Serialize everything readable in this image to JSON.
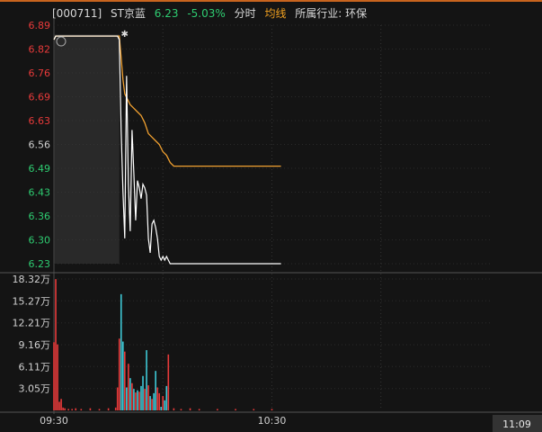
{
  "header": {
    "code": "[000711]",
    "name": "ST京蓝",
    "price": "6.23",
    "change": "-5.03%",
    "tab_fenshi": "分时",
    "tab_junxian": "均线",
    "industry": "所属行业: 环保"
  },
  "colors": {
    "up": "#e83a3a",
    "down": "#2ecc71",
    "neutral": "#d0d0d0",
    "price_line": "#ffffff",
    "avg_line": "#f0a030",
    "vol_up": "#e83a3a",
    "vol_down": "#3ec9d6"
  },
  "chart_data": {
    "type": "line",
    "price_ticks": [
      "6.89",
      "6.82",
      "6.76",
      "6.69",
      "6.63",
      "6.56",
      "6.49",
      "6.43",
      "6.36",
      "6.30",
      "6.23"
    ],
    "price_tick_colors": [
      "up",
      "up",
      "up",
      "up",
      "up",
      "neutral",
      "down",
      "down",
      "down",
      "down",
      "down"
    ],
    "ylim": [
      6.23,
      6.89
    ],
    "prev_close": 6.56,
    "volume_ticks": [
      "18.32万",
      "15.27万",
      "12.21万",
      "9.16万",
      "6.11万",
      "3.05万"
    ],
    "volume_ylim": [
      0,
      18.32
    ],
    "x_ticks": [
      "09:30",
      "10:30",
      "11:09"
    ],
    "price": [
      [
        0,
        6.85
      ],
      [
        1,
        6.86
      ],
      [
        2,
        6.86
      ],
      [
        3,
        6.86
      ],
      [
        5,
        6.86
      ],
      [
        10,
        6.86
      ],
      [
        20,
        6.86
      ],
      [
        30,
        6.86
      ],
      [
        35,
        6.86
      ],
      [
        36,
        6.85
      ],
      [
        37,
        6.6
      ],
      [
        38,
        6.43
      ],
      [
        39,
        6.3
      ],
      [
        40,
        6.75
      ],
      [
        41,
        6.45
      ],
      [
        42,
        6.32
      ],
      [
        43,
        6.6
      ],
      [
        44,
        6.48
      ],
      [
        45,
        6.35
      ],
      [
        46,
        6.46
      ],
      [
        47,
        6.44
      ],
      [
        48,
        6.41
      ],
      [
        49,
        6.45
      ],
      [
        50,
        6.44
      ],
      [
        51,
        6.42
      ],
      [
        52,
        6.3
      ],
      [
        53,
        6.26
      ],
      [
        54,
        6.34
      ],
      [
        55,
        6.35
      ],
      [
        56,
        6.33
      ],
      [
        57,
        6.3
      ],
      [
        58,
        6.25
      ],
      [
        59,
        6.24
      ],
      [
        60,
        6.25
      ],
      [
        61,
        6.24
      ],
      [
        62,
        6.25
      ],
      [
        63,
        6.24
      ],
      [
        64,
        6.23
      ],
      [
        70,
        6.23
      ],
      [
        80,
        6.23
      ],
      [
        90,
        6.23
      ],
      [
        100,
        6.23
      ],
      [
        110,
        6.23
      ],
      [
        125,
        6.23
      ]
    ],
    "avg": [
      [
        0,
        6.85
      ],
      [
        1,
        6.86
      ],
      [
        10,
        6.86
      ],
      [
        20,
        6.86
      ],
      [
        36,
        6.86
      ],
      [
        37,
        6.8
      ],
      [
        38,
        6.74
      ],
      [
        39,
        6.7
      ],
      [
        40,
        6.69
      ],
      [
        41,
        6.68
      ],
      [
        42,
        6.67
      ],
      [
        44,
        6.66
      ],
      [
        46,
        6.65
      ],
      [
        48,
        6.64
      ],
      [
        50,
        6.62
      ],
      [
        52,
        6.59
      ],
      [
        54,
        6.58
      ],
      [
        56,
        6.57
      ],
      [
        58,
        6.56
      ],
      [
        60,
        6.54
      ],
      [
        62,
        6.53
      ],
      [
        64,
        6.51
      ],
      [
        66,
        6.5
      ],
      [
        70,
        6.5
      ],
      [
        80,
        6.5
      ],
      [
        90,
        6.5
      ],
      [
        100,
        6.5
      ],
      [
        110,
        6.5
      ],
      [
        125,
        6.5
      ]
    ],
    "volume": [
      {
        "x": 0,
        "v": 9.5,
        "dir": "up"
      },
      {
        "x": 1,
        "v": 18.3,
        "dir": "up"
      },
      {
        "x": 2,
        "v": 9.2,
        "dir": "up"
      },
      {
        "x": 3,
        "v": 1.2,
        "dir": "up"
      },
      {
        "x": 4,
        "v": 1.6,
        "dir": "up"
      },
      {
        "x": 5,
        "v": 0.4,
        "dir": "up"
      },
      {
        "x": 6,
        "v": 0.3,
        "dir": "up"
      },
      {
        "x": 8,
        "v": 0.2,
        "dir": "up"
      },
      {
        "x": 10,
        "v": 0.2,
        "dir": "up"
      },
      {
        "x": 12,
        "v": 0.3,
        "dir": "up"
      },
      {
        "x": 15,
        "v": 0.2,
        "dir": "up"
      },
      {
        "x": 20,
        "v": 0.3,
        "dir": "up"
      },
      {
        "x": 25,
        "v": 0.2,
        "dir": "up"
      },
      {
        "x": 30,
        "v": 0.3,
        "dir": "up"
      },
      {
        "x": 34,
        "v": 0.4,
        "dir": "up"
      },
      {
        "x": 35,
        "v": 3.2,
        "dir": "up"
      },
      {
        "x": 36,
        "v": 10.0,
        "dir": "up"
      },
      {
        "x": 37,
        "v": 16.2,
        "dir": "down"
      },
      {
        "x": 38,
        "v": 9.6,
        "dir": "down"
      },
      {
        "x": 39,
        "v": 8.2,
        "dir": "up"
      },
      {
        "x": 40,
        "v": 3.2,
        "dir": "down"
      },
      {
        "x": 41,
        "v": 6.5,
        "dir": "up"
      },
      {
        "x": 42,
        "v": 4.5,
        "dir": "down"
      },
      {
        "x": 43,
        "v": 3.8,
        "dir": "up"
      },
      {
        "x": 44,
        "v": 3.0,
        "dir": "down"
      },
      {
        "x": 45,
        "v": 2.5,
        "dir": "up"
      },
      {
        "x": 46,
        "v": 2.8,
        "dir": "down"
      },
      {
        "x": 47,
        "v": 2.6,
        "dir": "up"
      },
      {
        "x": 48,
        "v": 3.4,
        "dir": "down"
      },
      {
        "x": 49,
        "v": 4.8,
        "dir": "down"
      },
      {
        "x": 50,
        "v": 3.0,
        "dir": "up"
      },
      {
        "x": 51,
        "v": 8.4,
        "dir": "down"
      },
      {
        "x": 52,
        "v": 3.5,
        "dir": "up"
      },
      {
        "x": 53,
        "v": 2.0,
        "dir": "down"
      },
      {
        "x": 54,
        "v": 1.6,
        "dir": "up"
      },
      {
        "x": 55,
        "v": 2.4,
        "dir": "down"
      },
      {
        "x": 56,
        "v": 5.5,
        "dir": "down"
      },
      {
        "x": 57,
        "v": 3.2,
        "dir": "up"
      },
      {
        "x": 58,
        "v": 2.4,
        "dir": "up"
      },
      {
        "x": 59,
        "v": 0.5,
        "dir": "down"
      },
      {
        "x": 60,
        "v": 2.0,
        "dir": "up"
      },
      {
        "x": 61,
        "v": 1.4,
        "dir": "down"
      },
      {
        "x": 62,
        "v": 3.4,
        "dir": "down"
      },
      {
        "x": 63,
        "v": 7.8,
        "dir": "up"
      },
      {
        "x": 66,
        "v": 0.3,
        "dir": "up"
      },
      {
        "x": 70,
        "v": 0.2,
        "dir": "up"
      },
      {
        "x": 75,
        "v": 0.3,
        "dir": "up"
      },
      {
        "x": 80,
        "v": 0.2,
        "dir": "up"
      },
      {
        "x": 90,
        "v": 0.2,
        "dir": "up"
      },
      {
        "x": 100,
        "v": 0.2,
        "dir": "up"
      },
      {
        "x": 110,
        "v": 0.2,
        "dir": "up"
      },
      {
        "x": 120,
        "v": 0.2,
        "dir": "up"
      }
    ]
  }
}
